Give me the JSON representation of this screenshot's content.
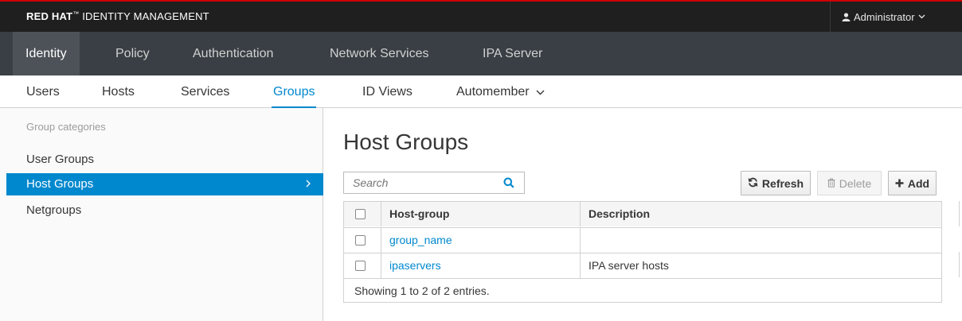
{
  "header": {
    "brand_bold": "RED HAT",
    "brand_rest": "IDENTITY MANAGEMENT",
    "user_label": "Administrator"
  },
  "main_nav": {
    "tabs": [
      {
        "label": "Identity",
        "active": true
      },
      {
        "label": "Policy"
      },
      {
        "label": "Authentication"
      },
      {
        "label": "Network Services"
      },
      {
        "label": "IPA Server"
      }
    ]
  },
  "sub_nav": {
    "items": [
      {
        "label": "Users"
      },
      {
        "label": "Hosts"
      },
      {
        "label": "Services"
      },
      {
        "label": "Groups",
        "active": true
      },
      {
        "label": "ID Views"
      },
      {
        "label": "Automember"
      }
    ]
  },
  "sidebar": {
    "heading": "Group categories",
    "items": [
      {
        "label": "User Groups"
      },
      {
        "label": "Host Groups",
        "active": true
      },
      {
        "label": "Netgroups"
      }
    ]
  },
  "content": {
    "title": "Host Groups",
    "search_placeholder": "Search",
    "buttons": {
      "refresh": "Refresh",
      "delete": "Delete",
      "add": "Add"
    },
    "table": {
      "columns": [
        "Host-group",
        "Description"
      ],
      "rows": [
        {
          "name": "group_name",
          "description": ""
        },
        {
          "name": "ipaservers",
          "description": "IPA server hosts"
        }
      ],
      "footer": "Showing 1 to 2 of 2 entries."
    }
  },
  "colors": {
    "accent": "#0088ce",
    "topbar": "#1f1f1f",
    "mainnav": "#393f44",
    "mainnav_active": "#4d5258",
    "brand_red": "#cc0000"
  }
}
